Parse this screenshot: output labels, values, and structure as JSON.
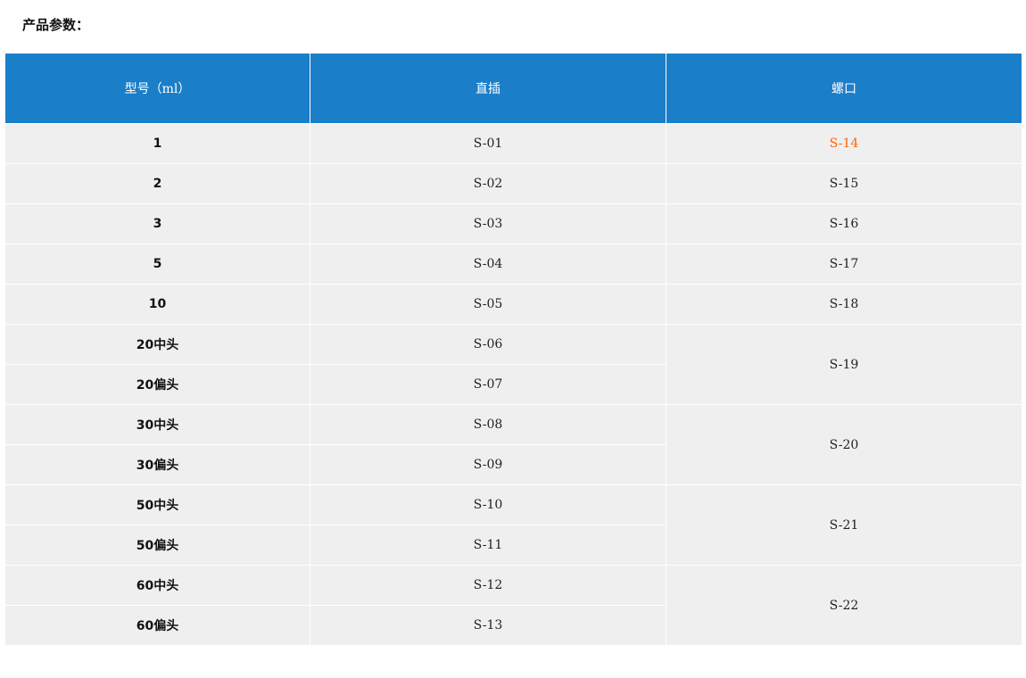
{
  "page": {
    "section_title": "产品参数："
  },
  "table": {
    "headers": {
      "model": "型号（ml）",
      "direct": "直插",
      "screw": "螺口"
    },
    "rows": [
      {
        "model": "1",
        "direct": "S-01",
        "screw": "S-14"
      },
      {
        "model": "2",
        "direct": "S-02",
        "screw": "S-15"
      },
      {
        "model": "3",
        "direct": "S-03",
        "screw": "S-16"
      },
      {
        "model": "5",
        "direct": "S-04",
        "screw": "S-17"
      },
      {
        "model": "10",
        "direct": "S-05",
        "screw": "S-18"
      },
      {
        "model": "20中头",
        "direct": "S-06",
        "screw": "S-19"
      },
      {
        "model": "20偏头",
        "direct": "S-07"
      },
      {
        "model": "30中头",
        "direct": "S-08",
        "screw": "S-20"
      },
      {
        "model": "30偏头",
        "direct": "S-09"
      },
      {
        "model": "50中头",
        "direct": "S-10",
        "screw": "S-21"
      },
      {
        "model": "50偏头",
        "direct": "S-11"
      },
      {
        "model": "60中头",
        "direct": "S-12",
        "screw": "S-22"
      },
      {
        "model": "60偏头",
        "direct": "S-13"
      }
    ]
  },
  "colors": {
    "header_bg": "#1b7ec8",
    "row_bg": "#efefef",
    "highlight_text": "#ff6600"
  }
}
